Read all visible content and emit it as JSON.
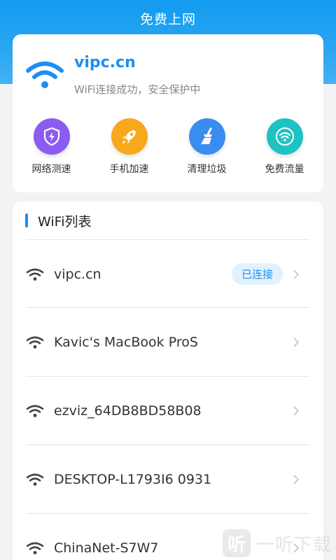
{
  "app": {
    "title": "免费上网"
  },
  "status": {
    "ssid": "vipc.cn",
    "message": "WiFi连接成功，安全保护中",
    "icon": "wifi-icon"
  },
  "tools": [
    {
      "label": "网络测速",
      "icon": "speed-shield-icon",
      "color": "#8a5cf0"
    },
    {
      "label": "手机加速",
      "icon": "rocket-icon",
      "color": "#f7a81b"
    },
    {
      "label": "清理垃圾",
      "icon": "broom-icon",
      "color": "#3a8df0"
    },
    {
      "label": "免费流量",
      "icon": "wifi-icon",
      "color": "#1fc2c2"
    }
  ],
  "wifi_list": {
    "title": "WiFi列表",
    "items": [
      {
        "name": "vipc.cn",
        "badge": "已连接"
      },
      {
        "name": "Kavic's MacBook ProS",
        "badge": ""
      },
      {
        "name": "ezviz_64DB8BD58B08",
        "badge": ""
      },
      {
        "name": "DESKTOP-L1793I6 0931",
        "badge": ""
      },
      {
        "name": "ChinaNet-S7W7",
        "badge": ""
      }
    ]
  },
  "watermark": {
    "logo": "听",
    "text": "一听下载"
  },
  "colors": {
    "accent": "#1c8ff0",
    "header": "#129bf0"
  }
}
